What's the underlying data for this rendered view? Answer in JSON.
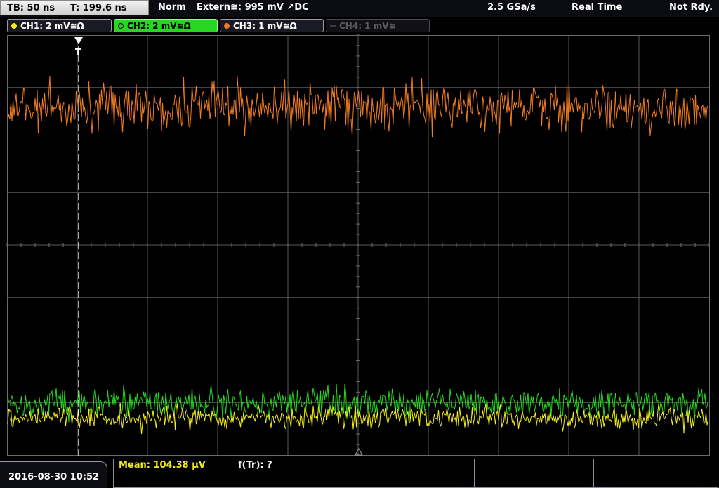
{
  "top": {
    "timebase": "TB: 50 ns",
    "trigger_time": "T: 199.6 ns",
    "trigger_mode": "Norm",
    "trigger_source": "Extern≅: 995 mV ↗DC",
    "sample_rate": "2.5 GSa/s",
    "acq_mode": "Real Time",
    "status": "Not Rdy."
  },
  "channels": [
    {
      "label": "CH1: 2 mV≅Ω",
      "color": "#f2ec17",
      "state": "on"
    },
    {
      "label": "CH2: 2 mV≅Ω",
      "color": "#27d622",
      "state": "selected"
    },
    {
      "label": "CH3: 1 mV≅Ω",
      "color": "#f07c22",
      "state": "on"
    },
    {
      "label": "CH4: 1 mV≅",
      "color": "#5c5c5c",
      "state": "off"
    }
  ],
  "trigger_marker": "T",
  "bottom": {
    "date": "2016-08-30 10:52",
    "measure_mean": "Mean: 104.38 µV",
    "measure_freq": "f(Tr): ?"
  },
  "colors": {
    "grid": "#5a5a5a",
    "ch1": "#f2ec17",
    "ch2": "#27d622",
    "ch3": "#f07c22"
  }
}
